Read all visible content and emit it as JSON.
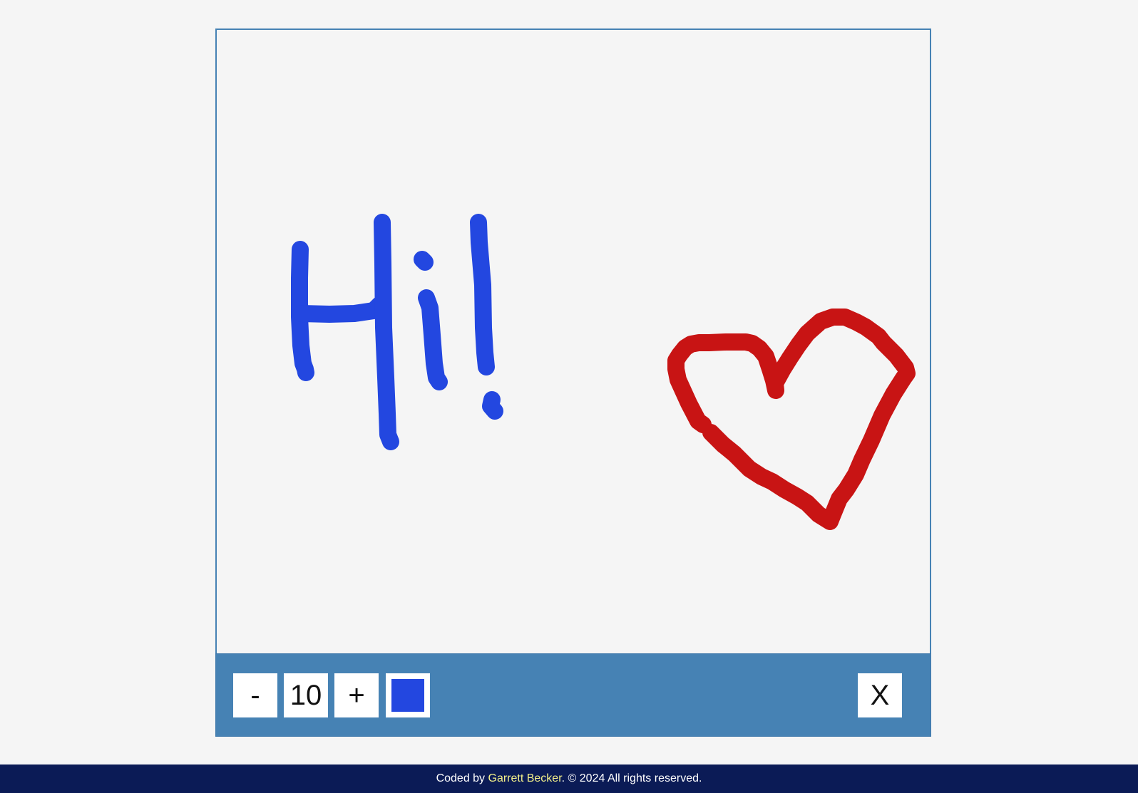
{
  "toolbox": {
    "decrease_label": "-",
    "size_value": "10",
    "increase_label": "+",
    "clear_label": "X",
    "current_color": "#2347e0",
    "background": "#4682b4"
  },
  "drawing": {
    "stroke_colors": [
      "#2347e0",
      "#c81414"
    ]
  },
  "footer": {
    "prefix": "Coded by ",
    "author": "Garrett Becker",
    "suffix": ". © 2024 All rights reserved.",
    "link_color": "#f3f08a",
    "background": "#0b1b56"
  }
}
